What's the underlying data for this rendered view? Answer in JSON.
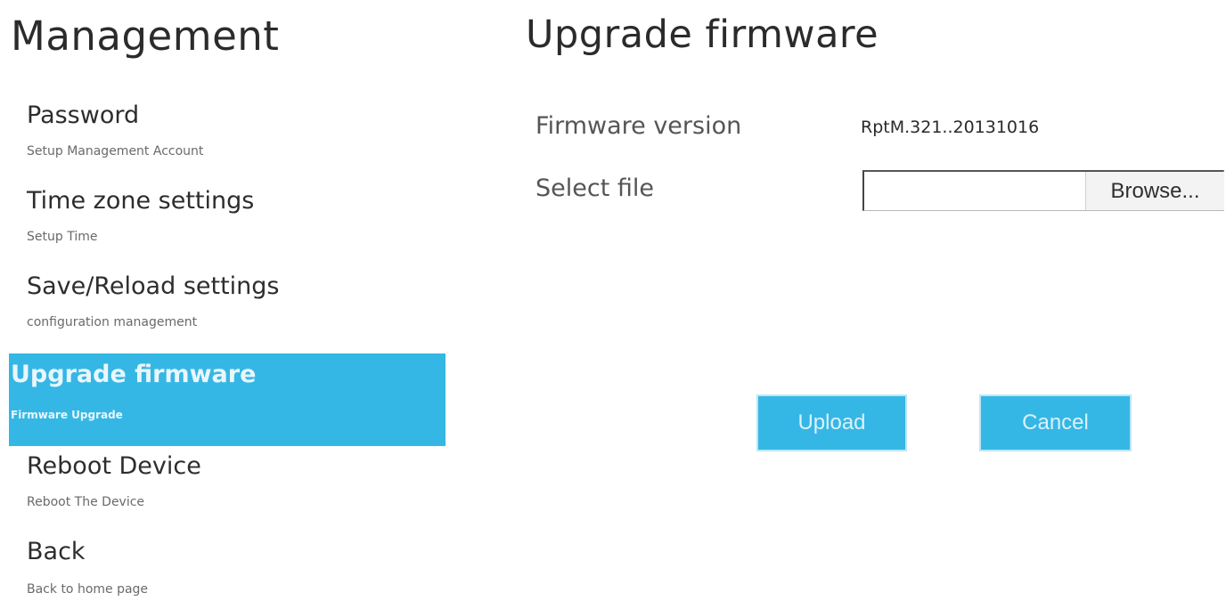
{
  "sidebar": {
    "title": "Management",
    "items": [
      {
        "label": "Password",
        "sub": "Setup Management Account",
        "active": false
      },
      {
        "label": "Time zone settings",
        "sub": "Setup Time",
        "active": false
      },
      {
        "label": "Save/Reload settings",
        "sub": "configuration management",
        "active": false
      },
      {
        "label": "Upgrade firmware",
        "sub": "Firmware Upgrade",
        "active": true
      },
      {
        "label": "Reboot Device",
        "sub": "Reboot The Device",
        "active": false
      },
      {
        "label": "Back",
        "sub": "Back to home page",
        "active": false
      }
    ]
  },
  "main": {
    "title": "Upgrade firmware",
    "firmware_version_label": "Firmware version",
    "firmware_version_value": "RptM.321..20131016",
    "select_file_label": "Select file",
    "file_input_value": "",
    "browse_label": "Browse...",
    "upload_label": "Upload",
    "cancel_label": "Cancel"
  },
  "colors": {
    "accent": "#35b7e5",
    "background": "#ffffff"
  }
}
